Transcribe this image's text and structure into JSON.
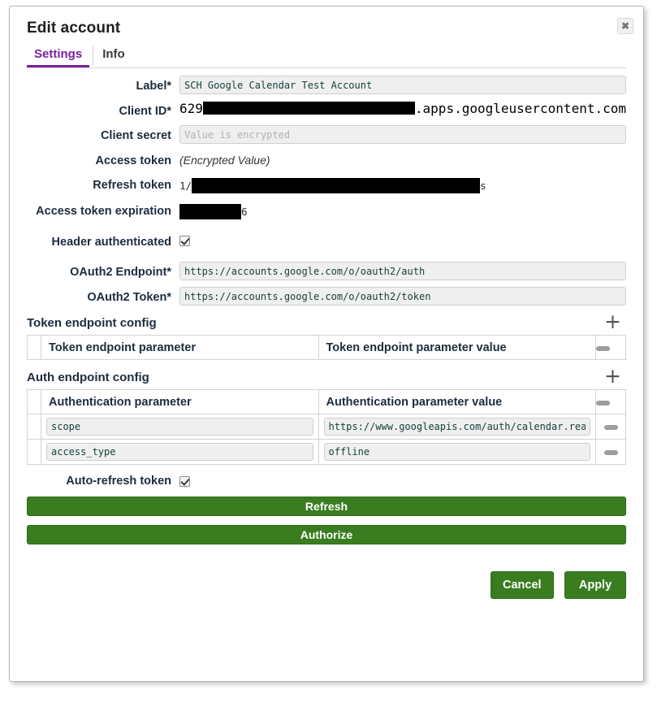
{
  "dialog": {
    "title": "Edit account",
    "close_label": "✖"
  },
  "tabs": [
    {
      "label": "Settings",
      "active": true
    },
    {
      "label": "Info",
      "active": false
    }
  ],
  "fields": {
    "label": {
      "label": "Label*",
      "value": "SCH Google Calendar Test Account",
      "placeholder": ""
    },
    "client_id": {
      "label": "Client ID*",
      "prefix": "629",
      "suffix": ".apps.googleusercontent.com",
      "redacted": true,
      "placeholder": ""
    },
    "client_secret": {
      "label": "Client secret",
      "value": "",
      "placeholder": "Value is encrypted"
    },
    "access_token": {
      "label": "Access token",
      "value": "(Encrypted Value)"
    },
    "refresh_token": {
      "label": "Refresh token",
      "prefix": "1/",
      "suffix": "s",
      "redacted": true
    },
    "access_token_expiration": {
      "label": "Access token expiration",
      "prefix": "",
      "suffix": "6",
      "redacted": true
    },
    "header_authenticated": {
      "label": "Header authenticated",
      "checked": true
    },
    "oauth2_endpoint": {
      "label": "OAuth2 Endpoint*",
      "value": "https://accounts.google.com/o/oauth2/auth"
    },
    "oauth2_token": {
      "label": "OAuth2 Token*",
      "value": "https://accounts.google.com/o/oauth2/token"
    },
    "auto_refresh_token": {
      "label": "Auto-refresh token",
      "checked": true
    }
  },
  "token_endpoint_config": {
    "title": "Token endpoint config",
    "add_label": "+",
    "columns": [
      "Token endpoint parameter",
      "Token endpoint parameter value"
    ],
    "rows": []
  },
  "auth_endpoint_config": {
    "title": "Auth endpoint config",
    "add_label": "+",
    "columns": [
      "Authentication parameter",
      "Authentication parameter value"
    ],
    "rows": [
      {
        "parameter": "scope",
        "value": "https://www.googleapis.com/auth/calendar.readonly"
      },
      {
        "parameter": "access_type",
        "value": "offline"
      }
    ]
  },
  "buttons": {
    "refresh": "Refresh",
    "authorize": "Authorize",
    "cancel": "Cancel",
    "apply": "Apply"
  },
  "colors": {
    "accent_purple": "#7b1fa2",
    "button_green": "#3a7d21",
    "label_navy": "#1d2c3d",
    "input_bg": "#efefef",
    "input_text": "#16413a"
  }
}
